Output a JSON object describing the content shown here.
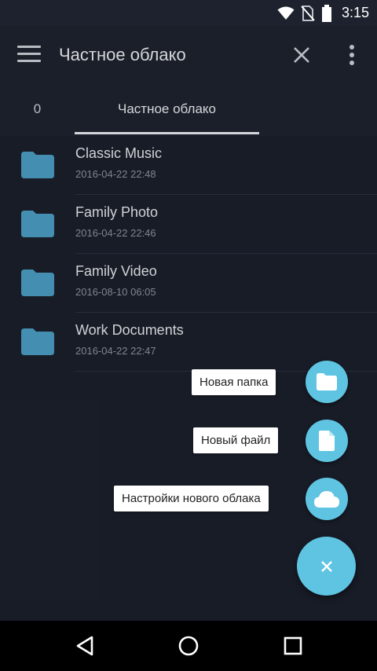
{
  "status_bar": {
    "time": "3:15"
  },
  "app_bar": {
    "title": "Частное облако"
  },
  "tabs": [
    {
      "label": "0"
    },
    {
      "label": "Частное облако",
      "selected": true
    }
  ],
  "files": [
    {
      "name": "Classic Music",
      "date": "2016-04-22 22:48",
      "icon": "folder-icon"
    },
    {
      "name": "Family Photo",
      "date": "2016-04-22 22:46",
      "icon": "folder-icon"
    },
    {
      "name": "Family Video",
      "date": "2016-08-10 06:05",
      "icon": "folder-icon"
    },
    {
      "name": "Work Documents",
      "date": "2016-04-22 22:47",
      "icon": "folder-icon"
    }
  ],
  "speed_dial": {
    "new_folder": "Новая папка",
    "new_file": "Новый файл",
    "new_cloud_settings": "Настройки нового облака"
  },
  "colors": {
    "background": "#1b1f2b",
    "accent": "#5fc4e2",
    "folder": "#4a9cc0"
  }
}
